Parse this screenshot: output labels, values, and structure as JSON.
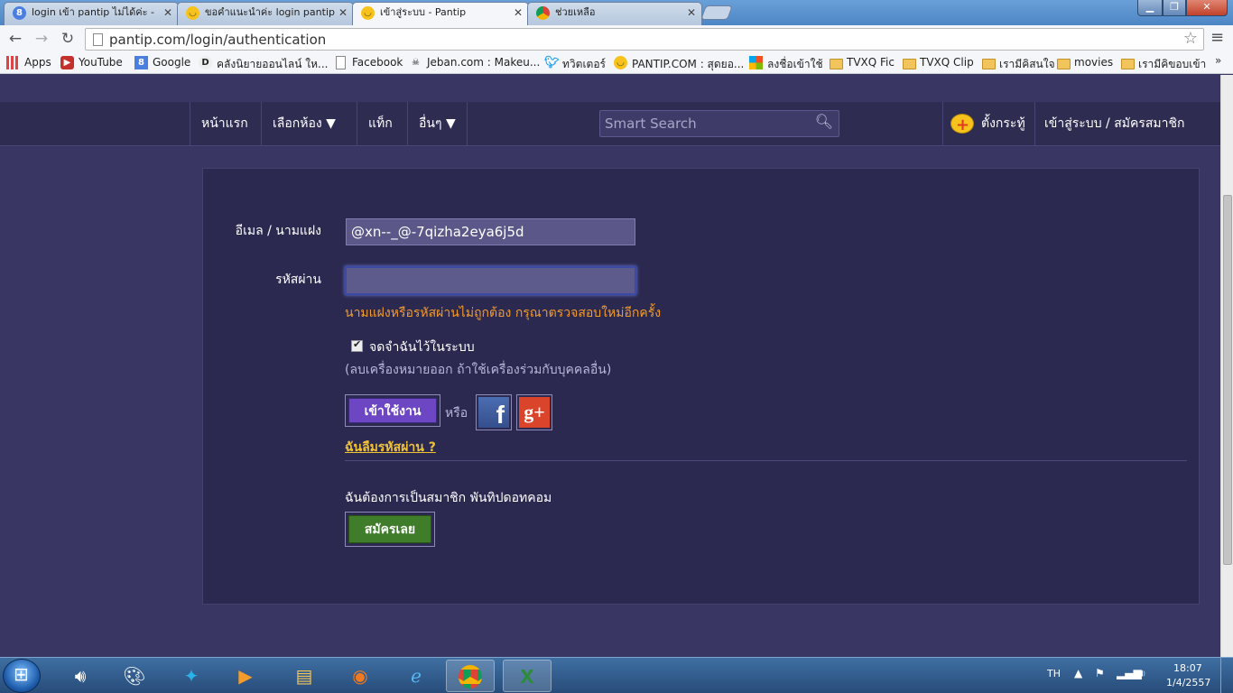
{
  "browser": {
    "tabs": [
      {
        "label": "login เข้า pantip ไม่ได้ค่ะ -",
        "favicon": "google-g-icon",
        "active": false
      },
      {
        "label": "ขอคำแนะนำค่ะ login pantip",
        "favicon": "pantip-face-icon",
        "active": false
      },
      {
        "label": "เข้าสู่ระบบ - Pantip",
        "favicon": "pantip-face-icon",
        "active": true
      },
      {
        "label": "ช่วยเหลือ",
        "favicon": "chrome-icon",
        "active": false
      }
    ],
    "url": "pantip.com/login/authentication",
    "bookmarks": [
      {
        "label": "Apps",
        "icon": "apps-grid-icon"
      },
      {
        "label": "YouTube",
        "icon": "youtube-icon"
      },
      {
        "label": "Google",
        "icon": "google-g-icon"
      },
      {
        "label": "คลังนิยายออนไลน์ ให...",
        "icon": "d-logo-icon"
      },
      {
        "label": "Facebook",
        "icon": "page-icon"
      },
      {
        "label": "Jeban.com : Makeu...",
        "icon": "jeban-icon"
      },
      {
        "label": "ทวิตเตอร์",
        "icon": "twitter-bird-icon"
      },
      {
        "label": "PANTIP.COM : สุดยอ...",
        "icon": "pantip-face-icon"
      },
      {
        "label": "ลงชื่อเข้าใช้",
        "icon": "windows-flag-icon"
      },
      {
        "label": "TVXQ Fic",
        "icon": "folder-icon"
      },
      {
        "label": "TVXQ Clip",
        "icon": "folder-icon"
      },
      {
        "label": "เรามีคิสนใจ",
        "icon": "folder-icon"
      },
      {
        "label": "movies",
        "icon": "folder-icon"
      },
      {
        "label": "เรามีคิขอบเข้า",
        "icon": "folder-icon"
      }
    ],
    "bookmarks_more": "»"
  },
  "navbar": {
    "items": [
      "หน้าแรก",
      "เลือกห้อง ▼",
      "แท็ก",
      "อื่นๆ ▼"
    ],
    "search_placeholder": "Smart Search",
    "new_topic": "ตั้งกระทู้",
    "login_register": "เข้าสู่ระบบ / สมัครสมาชิก"
  },
  "login": {
    "email_label": "อีเมล / นามแฝง",
    "email_value": "@xn--_@-7qizha2eya6j5d",
    "password_label": "รหัสผ่าน",
    "password_value": "",
    "error": "นามแฝงหรือรหัสผ่านไม่ถูกต้อง กรุณาตรวจสอบใหม่อีกครั้ง",
    "remember_label": "จดจำฉันไว้ในระบบ",
    "remember_checked": true,
    "remember_hint": "(ลบเครื่องหมายออก ถ้าใช้เครื่องร่วมกับบุคคลอื่น)",
    "login_button": "เข้าใช้งาน",
    "or": "หรือ",
    "facebook_glyph": "f",
    "google_glyph": "g+",
    "forgot": "ฉันลืมรหัสผ่าน ?",
    "register_prompt": "ฉันต้องการเป็นสมาชิก พันทิปดอทคอม",
    "register_button": "สมัครเลย"
  },
  "taskbar": {
    "apps": [
      "speaker-icon",
      "paint-icon",
      "dtac-icon",
      "media-player-icon",
      "file-explorer-icon",
      "firefox-icon",
      "internet-explorer-icon",
      "chrome-icon",
      "excel-icon"
    ],
    "language": "TH",
    "time": "18:07",
    "date": "1/4/2557"
  },
  "colors": {
    "page_bg": "#3a3663",
    "navbar_bg": "#2f2c52",
    "panel_bg": "#2c2950",
    "error": "#f29b2c",
    "link": "#f0c337",
    "login_button": "#6c46c3",
    "register_button": "#3f7d2a"
  }
}
